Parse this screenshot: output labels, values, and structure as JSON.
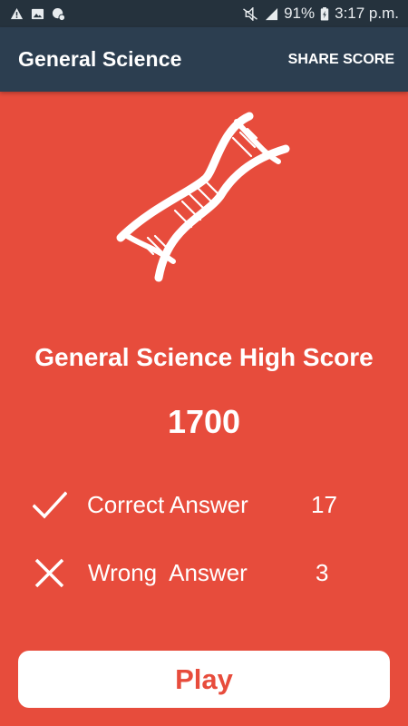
{
  "status_bar": {
    "battery": "91%",
    "time": "3:17 p.m.",
    "left_icons": [
      "warning-icon",
      "image-icon",
      "sync-icon"
    ],
    "right_icons": [
      "mute-icon",
      "signal-icon",
      "battery-icon"
    ]
  },
  "app_bar": {
    "title": "General Science",
    "share_label": "SHARE SCORE"
  },
  "hero": {
    "icon": "dna-icon"
  },
  "score": {
    "title": "General Science High Score",
    "value": "1700"
  },
  "stats": {
    "correct_label": "Correct Answer",
    "correct_value": "17",
    "wrong_label": "Wrong  Answer",
    "wrong_value": "3"
  },
  "play_label": "Play",
  "colors": {
    "accent": "#E74C3C",
    "app_bar": "#2C3E50",
    "status_bar": "#25323D",
    "text": "#FFFFFF"
  }
}
